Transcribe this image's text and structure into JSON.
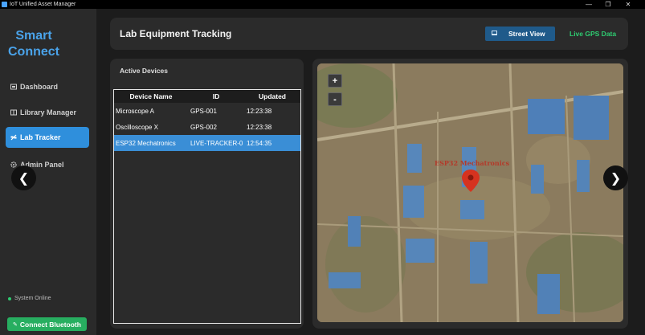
{
  "window": {
    "title": "IoT Unified Asset Manager",
    "controls": {
      "minimize": "—",
      "maximize": "❐",
      "close": "✕"
    }
  },
  "sidebar": {
    "brand_line1": "Smart",
    "brand_line2": "Connect",
    "items": [
      {
        "label": "Dashboard",
        "icon": "dashboard-icon",
        "active": false
      },
      {
        "label": "Library Manager",
        "icon": "library-icon",
        "active": false
      },
      {
        "label": "Lab Tracker",
        "icon": "satellite-icon",
        "active": true
      },
      {
        "label": "Admin Panel",
        "icon": "gear-icon",
        "active": false
      }
    ],
    "status_text": "System Online",
    "bluetooth_button": "Connect Bluetooth"
  },
  "header": {
    "title": "Lab Equipment Tracking",
    "street_view_button": "Street View",
    "gps_label": "Live GPS Data"
  },
  "devices_panel": {
    "title": "Active Devices",
    "columns": [
      "Device Name",
      "ID",
      "Updated"
    ],
    "rows": [
      {
        "name": "Microscope A",
        "id": "GPS-001",
        "updated": "12:23:38",
        "selected": false
      },
      {
        "name": "Oscilloscope X",
        "id": "GPS-002",
        "updated": "12:23:38",
        "selected": false
      },
      {
        "name": "ESP32 Mechatronics",
        "id": "LIVE-TRACKER-0",
        "updated": "12:54:35",
        "selected": true
      }
    ]
  },
  "map": {
    "zoom_in": "+",
    "zoom_out": "-",
    "marker_label": "ESP32 Mechatronics"
  },
  "carousel": {
    "prev": "❮",
    "next": "❯"
  },
  "colors": {
    "accent": "#2f8fdc",
    "online": "#2ecc71",
    "marker": "#d6331f"
  }
}
